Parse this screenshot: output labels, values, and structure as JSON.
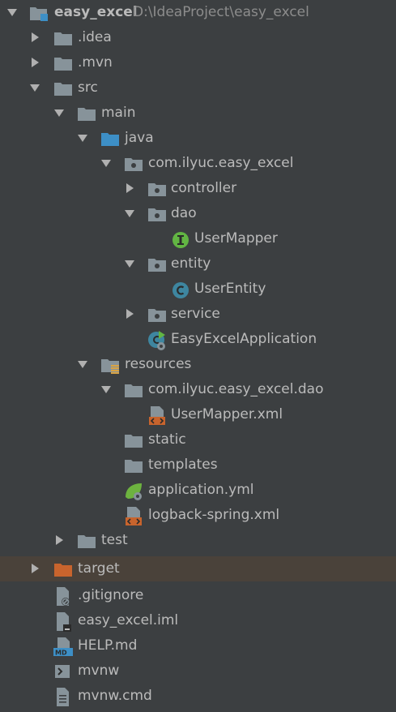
{
  "colors": {
    "background": "#3c3f41",
    "selected_row": "#4a423a",
    "text": "#bbbbbb",
    "path_text": "#8c8c8c",
    "folder_grey": "#87939a",
    "folder_blue": "#3d8fc6",
    "folder_orange": "#c8642d",
    "interface_green": "#62b543",
    "class_blue": "#3e86a0",
    "xml_orange": "#c8642d",
    "spring_green": "#6db33f"
  },
  "project": {
    "name": "easy_excel",
    "path": "D:\\IdeaProject\\easy_excel"
  },
  "tree": [
    {
      "label": "easy_excel",
      "icon": "project-folder-icon",
      "expanded": true
    },
    {
      "label": ".idea",
      "icon": "folder-icon",
      "expanded": false
    },
    {
      "label": ".mvn",
      "icon": "folder-icon",
      "expanded": false
    },
    {
      "label": "src",
      "icon": "folder-icon",
      "expanded": true
    },
    {
      "label": "main",
      "icon": "folder-icon",
      "expanded": true
    },
    {
      "label": "java",
      "icon": "source-folder-icon",
      "expanded": true
    },
    {
      "label": "com.ilyuc.easy_excel",
      "icon": "package-icon",
      "expanded": true
    },
    {
      "label": "controller",
      "icon": "package-icon",
      "expanded": false
    },
    {
      "label": "dao",
      "icon": "package-icon",
      "expanded": true
    },
    {
      "label": "UserMapper",
      "icon": "interface-icon"
    },
    {
      "label": "entity",
      "icon": "package-icon",
      "expanded": true
    },
    {
      "label": "UserEntity",
      "icon": "class-icon"
    },
    {
      "label": "service",
      "icon": "package-icon",
      "expanded": false
    },
    {
      "label": "EasyExcelApplication",
      "icon": "spring-boot-class-icon"
    },
    {
      "label": "resources",
      "icon": "resources-folder-icon",
      "expanded": true
    },
    {
      "label": "com.ilyuc.easy_excel.dao",
      "icon": "folder-icon",
      "expanded": true
    },
    {
      "label": "UserMapper.xml",
      "icon": "xml-file-icon"
    },
    {
      "label": "static",
      "icon": "folder-icon"
    },
    {
      "label": "templates",
      "icon": "folder-icon"
    },
    {
      "label": "application.yml",
      "icon": "spring-yml-icon"
    },
    {
      "label": "logback-spring.xml",
      "icon": "xml-file-icon"
    },
    {
      "label": "test",
      "icon": "folder-icon",
      "expanded": false
    },
    {
      "label": "target",
      "icon": "excluded-folder-icon",
      "expanded": false,
      "selected": true
    },
    {
      "label": ".gitignore",
      "icon": "gitignore-file-icon"
    },
    {
      "label": "easy_excel.iml",
      "icon": "iml-file-icon"
    },
    {
      "label": "HELP.md",
      "icon": "markdown-file-icon"
    },
    {
      "label": "mvnw",
      "icon": "shell-script-icon"
    },
    {
      "label": "mvnw.cmd",
      "icon": "text-file-icon"
    }
  ]
}
